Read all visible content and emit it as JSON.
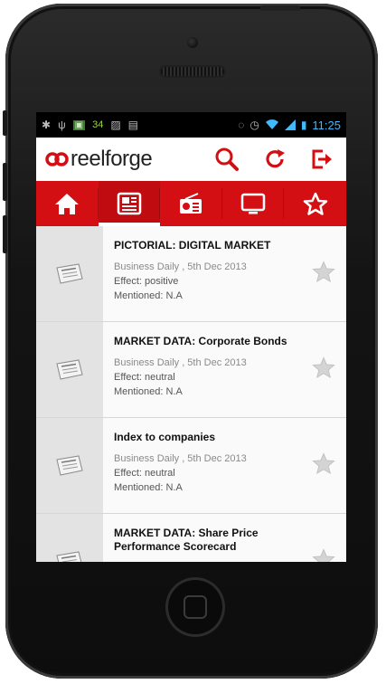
{
  "status_bar": {
    "badge_count": "34",
    "time": "11:25"
  },
  "app": {
    "logo_text": "reelforge",
    "brand_color": "#d40f14"
  },
  "header_actions": [
    {
      "name": "search-icon"
    },
    {
      "name": "refresh-icon"
    },
    {
      "name": "logout-icon"
    }
  ],
  "tabs": [
    {
      "name": "home-icon",
      "active": false
    },
    {
      "name": "newspaper-icon",
      "active": true
    },
    {
      "name": "radio-icon",
      "active": false
    },
    {
      "name": "tv-icon",
      "active": false
    },
    {
      "name": "star-icon",
      "active": false
    }
  ],
  "items": [
    {
      "title": "PICTORIAL: DIGITAL MARKET",
      "source": "Business Daily , 5th Dec 2013",
      "effect": "Effect: positive",
      "mentioned": "Mentioned: N.A"
    },
    {
      "title": "MARKET DATA: Corporate Bonds",
      "source": "Business Daily , 5th Dec 2013",
      "effect": "Effect: neutral",
      "mentioned": "Mentioned: N.A"
    },
    {
      "title": "Index to companies",
      "source": "Business Daily , 5th Dec 2013",
      "effect": "Effect: neutral",
      "mentioned": "Mentioned: N.A"
    },
    {
      "title": "MARKET DATA: Share Price Performance Scorecard",
      "source": "",
      "effect": "",
      "mentioned": ""
    }
  ]
}
